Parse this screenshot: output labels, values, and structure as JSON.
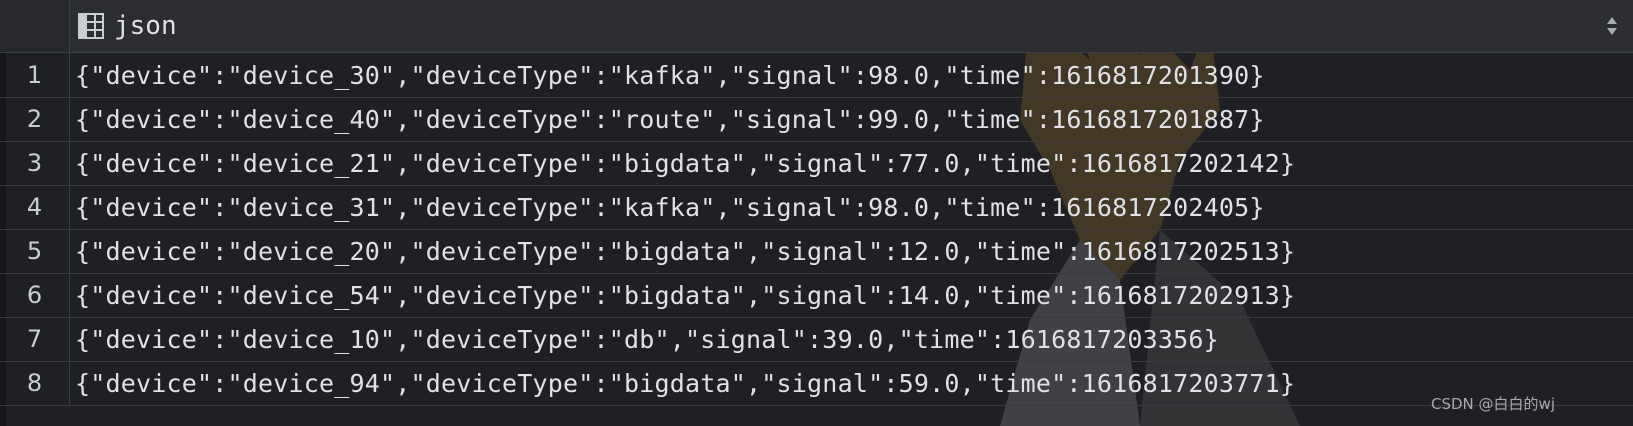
{
  "header": {
    "column_name": "json",
    "column_icon": "table-column-icon",
    "sort_icon": "sort-arrows-icon"
  },
  "rows": [
    {
      "num": "1",
      "value": "{\"device\":\"device_30\",\"deviceType\":\"kafka\",\"signal\":98.0,\"time\":1616817201390}"
    },
    {
      "num": "2",
      "value": "{\"device\":\"device_40\",\"deviceType\":\"route\",\"signal\":99.0,\"time\":1616817201887}"
    },
    {
      "num": "3",
      "value": "{\"device\":\"device_21\",\"deviceType\":\"bigdata\",\"signal\":77.0,\"time\":1616817202142}"
    },
    {
      "num": "4",
      "value": "{\"device\":\"device_31\",\"deviceType\":\"kafka\",\"signal\":98.0,\"time\":1616817202405}"
    },
    {
      "num": "5",
      "value": "{\"device\":\"device_20\",\"deviceType\":\"bigdata\",\"signal\":12.0,\"time\":1616817202513}"
    },
    {
      "num": "6",
      "value": "{\"device\":\"device_54\",\"deviceType\":\"bigdata\",\"signal\":14.0,\"time\":1616817202913}"
    },
    {
      "num": "7",
      "value": "{\"device\":\"device_10\",\"deviceType\":\"db\",\"signal\":39.0,\"time\":1616817203356}"
    },
    {
      "num": "8",
      "value": "{\"device\":\"device_94\",\"deviceType\":\"bigdata\",\"signal\":59.0,\"time\":1616817203771}"
    }
  ],
  "watermark": "CSDN @白白的wj",
  "colors": {
    "background": "#1f2023",
    "header": "#2b2d30",
    "text": "#dfe1e5",
    "grid_line": "#393b40"
  }
}
